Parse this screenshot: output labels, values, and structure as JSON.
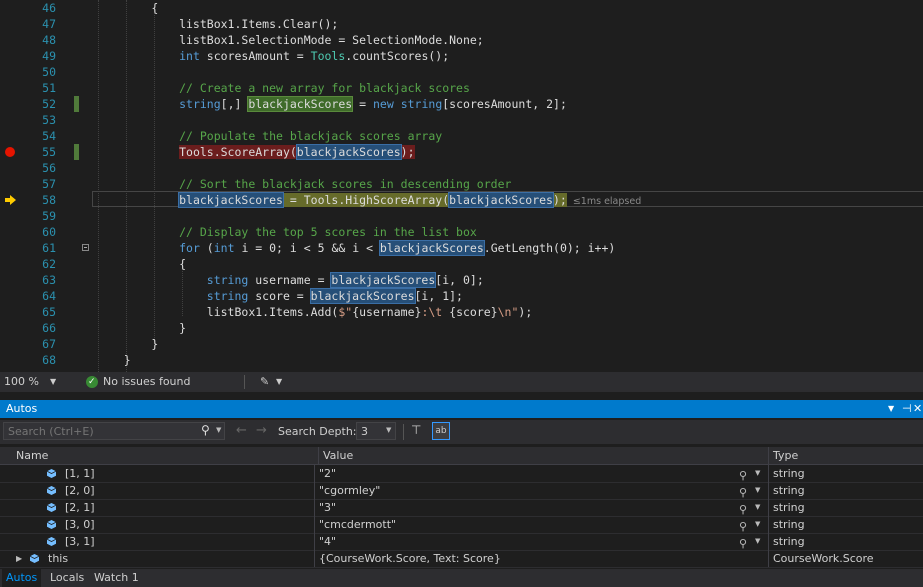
{
  "editor": {
    "lines": [
      {
        "n": "46",
        "parts": [
          {
            "t": "        {"
          }
        ]
      },
      {
        "n": "47",
        "parts": [
          {
            "t": "            listBox1.Items.Clear();"
          }
        ]
      },
      {
        "n": "48",
        "parts": [
          {
            "t": "            listBox1.SelectionMode = SelectionMode.None;"
          }
        ]
      },
      {
        "n": "49",
        "parts": [
          {
            "t": "            ",
            "c": ""
          },
          {
            "t": "int",
            "c": "kw"
          },
          {
            "t": " scoresAmount = "
          },
          {
            "t": "Tools",
            "c": "ty"
          },
          {
            "t": ".countScores();"
          }
        ]
      },
      {
        "n": "50",
        "parts": [
          {
            "t": ""
          }
        ]
      },
      {
        "n": "51",
        "parts": [
          {
            "t": "            "
          },
          {
            "t": "// Create a new array for blackjack scores",
            "c": "cm"
          }
        ]
      },
      {
        "n": "52",
        "parts": [
          {
            "t": "            "
          },
          {
            "t": "string",
            "c": "kw"
          },
          {
            "t": "[,] "
          },
          {
            "t": "blackjackScores",
            "c": "hl-green"
          },
          {
            "t": " = "
          },
          {
            "t": "new",
            "c": "kw"
          },
          {
            "t": " "
          },
          {
            "t": "string",
            "c": "kw"
          },
          {
            "t": "[scoresAmount, 2];"
          }
        ]
      },
      {
        "n": "53",
        "parts": [
          {
            "t": ""
          }
        ]
      },
      {
        "n": "54",
        "parts": [
          {
            "t": "            "
          },
          {
            "t": "// Populate the blackjack scores array",
            "c": "cm"
          }
        ]
      },
      {
        "n": "55",
        "parts": [
          {
            "t": "            "
          },
          {
            "t": "Tools.ScoreArray(",
            "c": "hl-red"
          },
          {
            "t": "blackjackScores",
            "c": "hl"
          },
          {
            "t": ");",
            "c": "hl-red"
          }
        ]
      },
      {
        "n": "56",
        "parts": [
          {
            "t": ""
          }
        ]
      },
      {
        "n": "57",
        "parts": [
          {
            "t": "            "
          },
          {
            "t": "// Sort the blackjack scores in descending order",
            "c": "cm"
          }
        ]
      },
      {
        "n": "58",
        "parts": [
          {
            "t": "            "
          },
          {
            "t": "blackjackScores",
            "c": "hl"
          },
          {
            "t": " = Tools.HighScoreArray(",
            "c": "hl-yellow"
          },
          {
            "t": "blackjackScores",
            "c": "hl"
          },
          {
            "t": ");",
            "c": "hl-yellow"
          }
        ],
        "elapsed": "≤1ms elapsed"
      },
      {
        "n": "59",
        "parts": [
          {
            "t": ""
          }
        ]
      },
      {
        "n": "60",
        "parts": [
          {
            "t": "            "
          },
          {
            "t": "// Display the top 5 scores in the list box",
            "c": "cm"
          }
        ]
      },
      {
        "n": "61",
        "parts": [
          {
            "t": "            "
          },
          {
            "t": "for",
            "c": "kw"
          },
          {
            "t": " ("
          },
          {
            "t": "int",
            "c": "kw"
          },
          {
            "t": " i = 0; i < 5 && i < "
          },
          {
            "t": "blackjackScores",
            "c": "hl"
          },
          {
            "t": ".GetLength(0); i++)"
          }
        ]
      },
      {
        "n": "62",
        "parts": [
          {
            "t": "            {"
          }
        ]
      },
      {
        "n": "63",
        "parts": [
          {
            "t": "                "
          },
          {
            "t": "string",
            "c": "kw"
          },
          {
            "t": " username = "
          },
          {
            "t": "blackjackScores",
            "c": "hl"
          },
          {
            "t": "[i, 0];"
          }
        ]
      },
      {
        "n": "64",
        "parts": [
          {
            "t": "                "
          },
          {
            "t": "string",
            "c": "kw"
          },
          {
            "t": " score = "
          },
          {
            "t": "blackjackScores",
            "c": "hl"
          },
          {
            "t": "[i, 1];"
          }
        ]
      },
      {
        "n": "65",
        "parts": [
          {
            "t": "                listBox1.Items.Add("
          },
          {
            "t": "$\"",
            "c": "st"
          },
          {
            "t": "{username}"
          },
          {
            "t": ":\\t ",
            "c": "st"
          },
          {
            "t": "{score}"
          },
          {
            "t": "\\n\"",
            "c": "st"
          },
          {
            "t": ");"
          }
        ]
      },
      {
        "n": "66",
        "parts": [
          {
            "t": "            }"
          }
        ]
      },
      {
        "n": "67",
        "parts": [
          {
            "t": "        }"
          }
        ]
      },
      {
        "n": "68",
        "parts": [
          {
            "t": "    }"
          }
        ]
      }
    ]
  },
  "statusbar": {
    "zoom": "100 %",
    "issues": "No issues found"
  },
  "panel": {
    "title": "Autos",
    "search_placeholder": "Search (Ctrl+E)",
    "search_depth_label": "Search Depth:",
    "search_depth_value": "3",
    "columns": {
      "name": "Name",
      "value": "Value",
      "type": "Type"
    },
    "rows": [
      {
        "name": "[1, 1]",
        "value": "\"2\"",
        "type": "string",
        "expandable": false
      },
      {
        "name": "[2, 0]",
        "value": "\"cgormley\"",
        "type": "string",
        "expandable": false
      },
      {
        "name": "[2, 1]",
        "value": "\"3\"",
        "type": "string",
        "expandable": false
      },
      {
        "name": "[3, 0]",
        "value": "\"cmcdermott\"",
        "type": "string",
        "expandable": false
      },
      {
        "name": "[3, 1]",
        "value": "\"4\"",
        "type": "string",
        "expandable": false
      },
      {
        "name": "this",
        "value": "{CourseWork.Score, Text: Score}",
        "type": "CourseWork.Score",
        "expandable": true
      }
    ],
    "tabs": [
      "Autos",
      "Locals",
      "Watch 1"
    ]
  },
  "colors": {
    "accent": "#007acc",
    "breakpoint": "#e51400",
    "current_statement": "#ffcc00"
  }
}
